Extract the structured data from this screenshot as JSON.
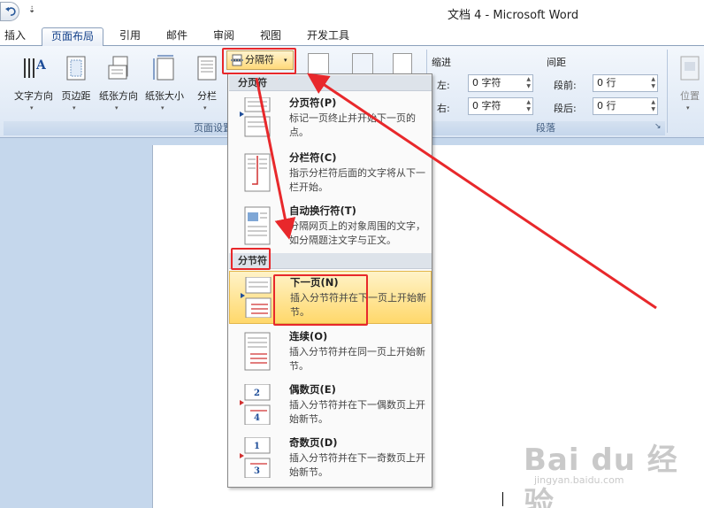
{
  "window": {
    "title": "文档 4 - Microsoft Word",
    "qat_dropdown": "⇣"
  },
  "tabs": [
    {
      "label": "插入"
    },
    {
      "label": "页面布局"
    },
    {
      "label": "引用"
    },
    {
      "label": "邮件"
    },
    {
      "label": "审阅"
    },
    {
      "label": "视图"
    },
    {
      "label": "开发工具"
    }
  ],
  "ribbon": {
    "page_setup": {
      "group_label": "页面设置",
      "buttons": [
        {
          "label": "文字方向",
          "arrow": "▾"
        },
        {
          "label": "页边距",
          "arrow": "▾"
        },
        {
          "label": "纸张方向",
          "arrow": "▾"
        },
        {
          "label": "纸张大小",
          "arrow": "▾"
        },
        {
          "label": "分栏",
          "arrow": "▾"
        }
      ],
      "breaks_button": {
        "label": "分隔符",
        "arrow": "▾"
      }
    },
    "paragraph": {
      "group_label": "段落",
      "indent_label": "缩进",
      "spacing_label": "间距",
      "left_label": "左:",
      "right_label": "右:",
      "before_label": "段前:",
      "after_label": "段后:",
      "left_value": "0 字符",
      "right_value": "0 字符",
      "before_value": "0 行",
      "after_value": "0 行",
      "launcher": "↘"
    },
    "arrange": {
      "position_label": "位置",
      "arrow": "▾"
    }
  },
  "menu": {
    "page_breaks_header": "分页符",
    "section_breaks_header": "分节符",
    "items": [
      {
        "title": "分页符(P)",
        "desc": "标记一页终止并开始下一页的点。"
      },
      {
        "title": "分栏符(C)",
        "desc": "指示分栏符后面的文字将从下一栏开始。"
      },
      {
        "title": "自动换行符(T)",
        "desc": "分隔网页上的对象周围的文字，如分隔题注文字与正文。"
      },
      {
        "title": "下一页(N)",
        "desc": "插入分节符并在下一页上开始新节。"
      },
      {
        "title": "连续(O)",
        "desc": "插入分节符并在同一页上开始新节。"
      },
      {
        "title": "偶数页(E)",
        "desc": "插入分节符并在下一偶数页上开始新节。"
      },
      {
        "title": "奇数页(D)",
        "desc": "插入分节符并在下一奇数页上开始新节。"
      }
    ],
    "even_icon_numbers": [
      "2",
      "4"
    ],
    "odd_icon_numbers": [
      "1",
      "3"
    ]
  },
  "watermark": {
    "brand": "Bai du 经验",
    "url": "jingyan.baidu.com"
  },
  "colors": {
    "annotation": "#e8282b",
    "highlight": "#ffd86b",
    "ribbon": "#dbe6f4"
  }
}
